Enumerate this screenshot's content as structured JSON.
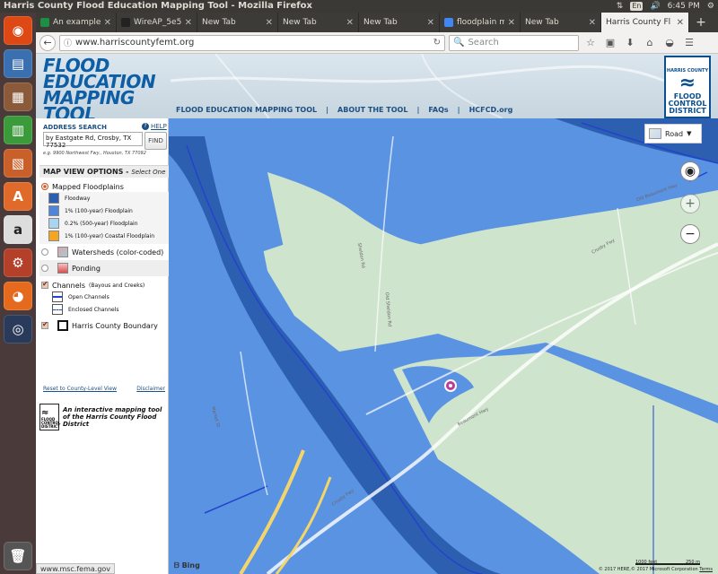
{
  "os": {
    "window_title": "Harris County Flood Education Mapping Tool - Mozilla Firefox",
    "tray": {
      "keyboard": "En",
      "time": "6:45 PM"
    },
    "launcher": [
      "ubuntu-icon",
      "files-icon",
      "writer-icon",
      "calc-icon",
      "impress-icon",
      "software-center-icon",
      "amazon-icon",
      "settings-icon",
      "firefox-icon",
      "steam-icon",
      "trash-icon"
    ]
  },
  "browser": {
    "tabs": [
      {
        "label": "An example",
        "icon": "spreadsheet-icon",
        "color": "#1d8f45"
      },
      {
        "label": "WireAP_5e5",
        "icon": "github-icon",
        "color": "#222222"
      },
      {
        "label": "New Tab",
        "icon": "",
        "color": ""
      },
      {
        "label": "New Tab",
        "icon": "",
        "color": ""
      },
      {
        "label": "New Tab",
        "icon": "",
        "color": ""
      },
      {
        "label": "floodplain m",
        "icon": "google-icon",
        "color": "#4285f4"
      },
      {
        "label": "New Tab",
        "icon": "",
        "color": ""
      },
      {
        "label": "Harris County Fl",
        "icon": "",
        "color": "",
        "active": true
      }
    ],
    "url": "www.harriscountyfemt.org",
    "search_placeholder": "Search",
    "status_url": "www.msc.fema.gov"
  },
  "site": {
    "logo_lines": [
      "FLOOD",
      "EDUCATION",
      "MAPPING TOOL"
    ],
    "nav": [
      "FLOOD EDUCATION MAPPING TOOL",
      "ABOUT THE TOOL",
      "FAQs",
      "HCFCD.org"
    ],
    "hcfcd_logo": [
      "HARRIS COUNTY",
      "FLOOD",
      "CONTROL",
      "DISTRICT"
    ]
  },
  "sidebar": {
    "address_title": "ADDRESS SEARCH",
    "help_label": "HELP",
    "address_value": "by Eastgate Rd, Crosby, TX 77532",
    "find_label": "FIND",
    "address_hint": "e.g. 9900 Northwest Fwy., Houston, TX 77092",
    "map_view_title": "MAP VIEW OPTIONS -",
    "map_view_hint": "Select One",
    "mapped_floodplains": "Mapped Floodplains",
    "legend": [
      {
        "label": "Floodway",
        "color": "#2d5fb0"
      },
      {
        "label": "1% (100-year) Floodplain",
        "color": "#4f86d9"
      },
      {
        "label": "0.2% (500-year) Floodplain",
        "color": "#a9d5f0"
      },
      {
        "label": "1% (100-year) Coastal Floodplain",
        "color": "#f4a521"
      }
    ],
    "watersheds": "Watersheds (color-coded)",
    "ponding": "Ponding",
    "channels": "Channels",
    "channels_sub": "(Bayous and Creeks)",
    "open_channels": "Open Channels",
    "enclosed_channels": "Enclosed Channels",
    "county_boundary": "Harris County Boundary",
    "reset_link": "Reset to County-Level View",
    "disclaimer_link": "Disclaimer",
    "tagline": "An interactive mapping tool of the Harris County Flood District",
    "mini_logo": [
      "FLOOD",
      "CONTROL",
      "DISTRICT"
    ]
  },
  "map": {
    "style_label": "Road",
    "bing_label": "Bing",
    "copyright": "© 2017 HERE,© 2017 Microsoft Corporation",
    "terms": "Terms",
    "scale_feet": "1000 feet",
    "scale_m": "250 m",
    "roads": [
      "Crosby Fwy",
      "Beaumont Hwy",
      "Crosby Fwy",
      "Old Beaumont Hwy",
      "Market St",
      "Sheldon Rd",
      "Old Sheldon Rd"
    ]
  }
}
